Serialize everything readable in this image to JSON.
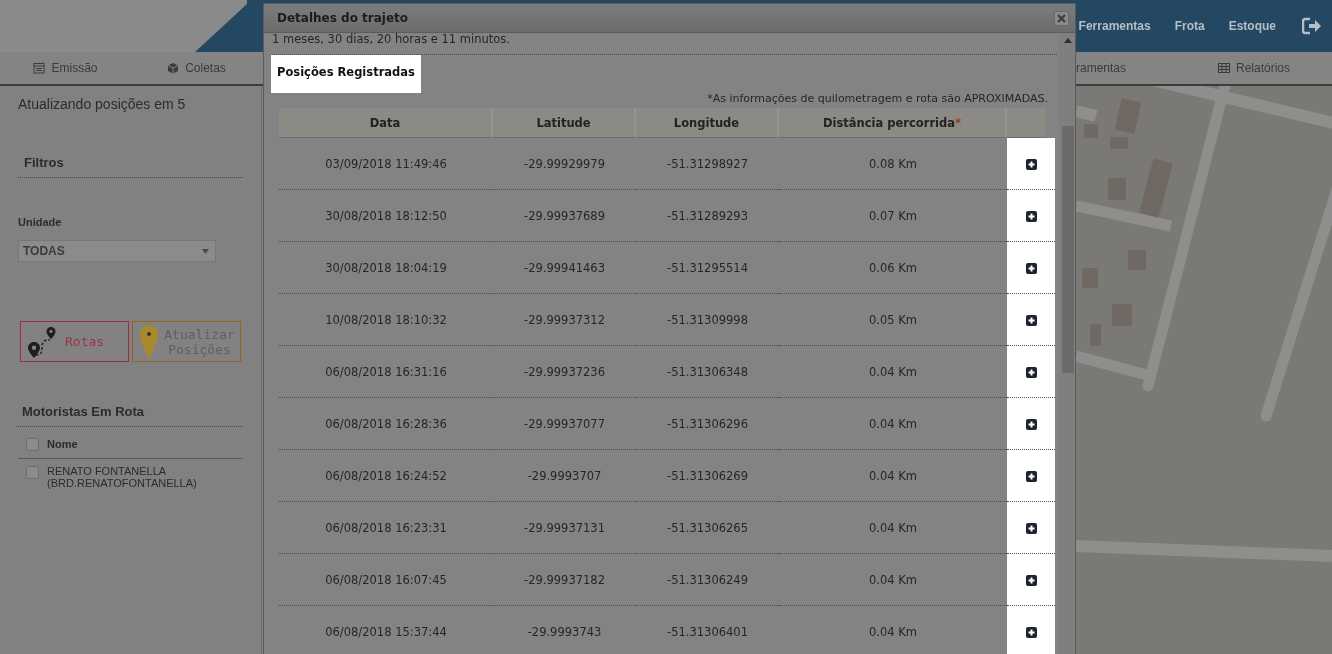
{
  "header": {
    "nav_links": [
      "Ferramentas",
      "Frota",
      "Estoque"
    ]
  },
  "navbar": {
    "tabs": [
      {
        "label": "Emissão",
        "kind": "calendar"
      },
      {
        "label": "Coletas",
        "kind": "cube"
      },
      {
        "label": "ramentas",
        "kind": "plain"
      },
      {
        "label": "Relatórios",
        "kind": "table"
      }
    ]
  },
  "sidebar": {
    "status": "Atualizando posições em 5",
    "filters_title": "Filtros",
    "unit_label": "Unidade",
    "unit_value": "TODAS",
    "buttons": [
      {
        "label": "Rotas",
        "kind": "route"
      },
      {
        "label": "Atualizar Posições",
        "kind": "pin"
      }
    ],
    "drivers_title": "Motoristas Em Rota",
    "drivers_header": {
      "label": "Nome",
      "checked": false
    },
    "drivers": [
      {
        "name": "RENATO FONTANELLA (BRD.RENATOFONTANELLA)",
        "checked": false
      }
    ]
  },
  "modal": {
    "title": "Detalhes do trajeto",
    "duration": "1 meses, 30 dias, 20 horas e 11 minutos.",
    "section_title": "Posições Registradas",
    "note": "*As informações de quilometragem e rota são APROXIMADAS.",
    "columns": [
      {
        "label": "Data"
      },
      {
        "label": "Latitude"
      },
      {
        "label": "Longitude"
      },
      {
        "label": "Distância percorrida",
        "mark": "*"
      }
    ],
    "rows": [
      {
        "date": "03/09/2018 11:49:46",
        "latitude": "-29.99929979",
        "longitude": "-51.31298927",
        "distance": "0.08 Km"
      },
      {
        "date": "30/08/2018 18:12:50",
        "latitude": "-29.99937689",
        "longitude": "-51.31289293",
        "distance": "0.07 Km"
      },
      {
        "date": "30/08/2018 18:04:19",
        "latitude": "-29.99941463",
        "longitude": "-51.31295514",
        "distance": "0.06 Km"
      },
      {
        "date": "10/08/2018 18:10:32",
        "latitude": "-29.99937312",
        "longitude": "-51.31309998",
        "distance": "0.05 Km"
      },
      {
        "date": "06/08/2018 16:31:16",
        "latitude": "-29.99937236",
        "longitude": "-51.31306348",
        "distance": "0.04 Km"
      },
      {
        "date": "06/08/2018 16:28:36",
        "latitude": "-29.99937077",
        "longitude": "-51.31306296",
        "distance": "0.04 Km"
      },
      {
        "date": "06/08/2018 16:24:52",
        "latitude": "-29.9993707",
        "longitude": "-51.31306269",
        "distance": "0.04 Km"
      },
      {
        "date": "06/08/2018 16:23:31",
        "latitude": "-29.99937131",
        "longitude": "-51.31306265",
        "distance": "0.04 Km"
      },
      {
        "date": "06/08/2018 16:07:45",
        "latitude": "-29.99937182",
        "longitude": "-51.31306249",
        "distance": "0.04 Km"
      },
      {
        "date": "06/08/2018 15:37:44",
        "latitude": "-29.9993743",
        "longitude": "-51.31306401",
        "distance": "0.04 Km"
      }
    ]
  }
}
